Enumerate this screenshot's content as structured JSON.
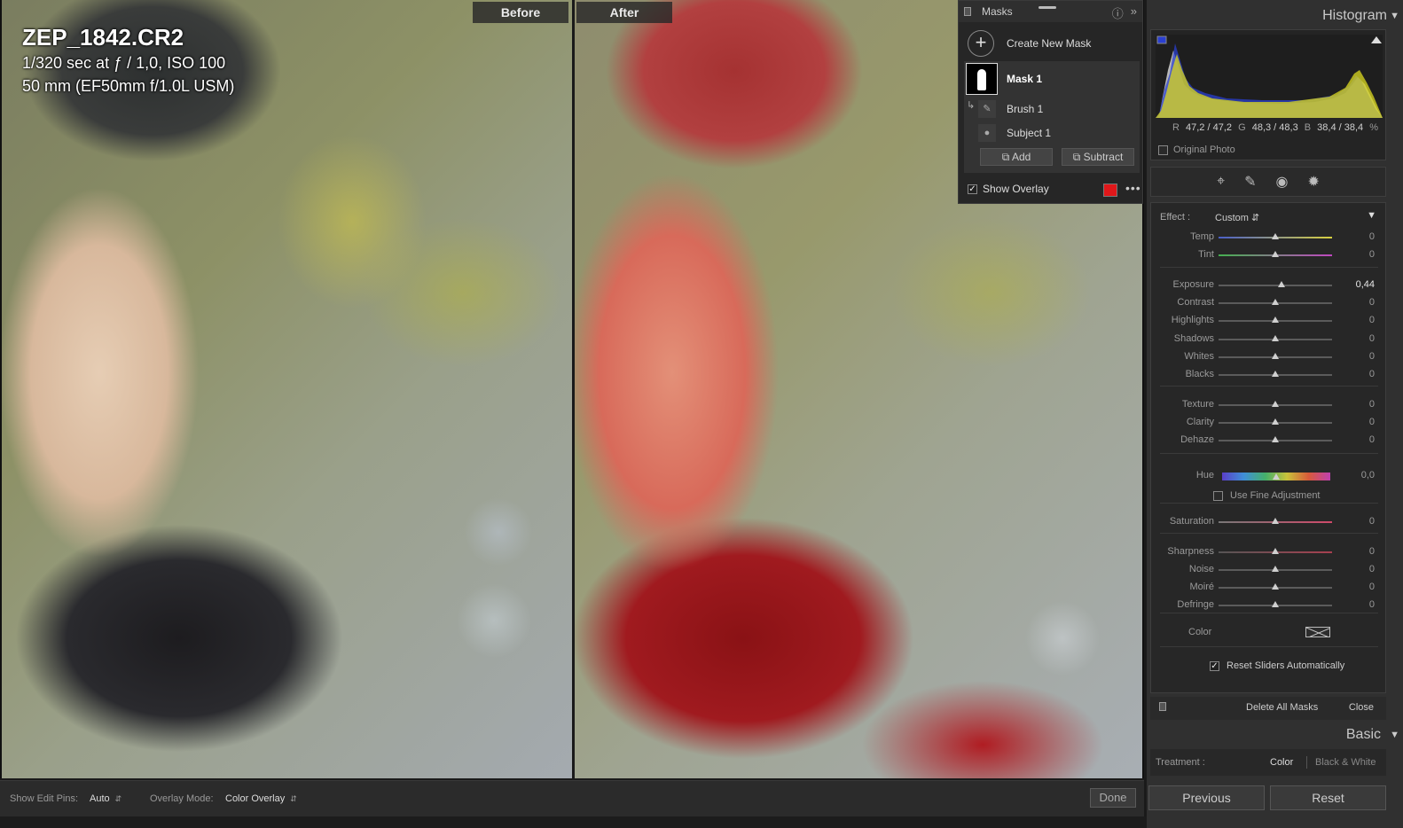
{
  "photo": {
    "before_label": "Before",
    "after_label": "After",
    "filename": "ZEP_1842.CR2",
    "exposure_line": "1/320 sec at ƒ / 1,0, ISO 100",
    "lens_line": "50 mm (EF50mm f/1.0L USM)"
  },
  "masks": {
    "title": "Masks",
    "create_label": "Create New Mask",
    "mask_name": "Mask 1",
    "components": [
      {
        "label": "Brush 1",
        "icon": "brush-icon"
      },
      {
        "label": "Subject 1",
        "icon": "person-icon"
      }
    ],
    "add_label": "Add",
    "subtract_label": "Subtract",
    "show_overlay_label": "Show Overlay",
    "show_overlay_checked": true,
    "overlay_color": "#e0171a"
  },
  "histogram": {
    "title": "Histogram",
    "r_label": "R",
    "r_value": "47,2 / 47,2",
    "g_label": "G",
    "g_value": "48,3 / 48,3",
    "b_label": "B",
    "b_value": "38,4 / 38,4",
    "unit": "%",
    "original_photo_label": "Original Photo"
  },
  "tools": [
    "crop-icon",
    "healing-icon",
    "red-eye-icon",
    "masking-icon"
  ],
  "mask_settings": {
    "effect_label": "Effect :",
    "effect_value": "Custom",
    "sliders": [
      {
        "label": "Temp",
        "value": "0",
        "pos": 0.5
      },
      {
        "label": "Tint",
        "value": "0",
        "pos": 0.5
      },
      {
        "label": "Exposure",
        "value": "0,44",
        "pos": 0.555
      },
      {
        "label": "Contrast",
        "value": "0",
        "pos": 0.5
      },
      {
        "label": "Highlights",
        "value": "0",
        "pos": 0.5
      },
      {
        "label": "Shadows",
        "value": "0",
        "pos": 0.5
      },
      {
        "label": "Whites",
        "value": "0",
        "pos": 0.5
      },
      {
        "label": "Blacks",
        "value": "0",
        "pos": 0.5
      },
      {
        "label": "Texture",
        "value": "0",
        "pos": 0.5
      },
      {
        "label": "Clarity",
        "value": "0",
        "pos": 0.5
      },
      {
        "label": "Dehaze",
        "value": "0",
        "pos": 0.5
      },
      {
        "label": "Hue",
        "value": "0,0",
        "pos": 0.5
      },
      {
        "label": "Saturation",
        "value": "0",
        "pos": 0.5
      },
      {
        "label": "Sharpness",
        "value": "0",
        "pos": 0.5
      },
      {
        "label": "Noise",
        "value": "0",
        "pos": 0.5
      },
      {
        "label": "Moiré",
        "value": "0",
        "pos": 0.5
      },
      {
        "label": "Defringe",
        "value": "0",
        "pos": 0.5
      }
    ],
    "fine_adjustment_label": "Use Fine Adjustment",
    "color_label": "Color",
    "reset_auto_label": "Reset Sliders Automatically",
    "reset_auto_checked": true
  },
  "mask_footer": {
    "delete_label": "Delete All Masks",
    "close_label": "Close"
  },
  "basic": {
    "title": "Basic",
    "treatment_label": "Treatment :",
    "color_option": "Color",
    "bw_option": "Black & White"
  },
  "bottom_buttons": {
    "previous": "Previous",
    "reset": "Reset"
  },
  "toolbar": {
    "edit_pins_label": "Show Edit Pins:",
    "edit_pins_value": "Auto",
    "overlay_mode_label": "Overlay Mode:",
    "overlay_mode_value": "Color Overlay",
    "done_label": "Done"
  }
}
